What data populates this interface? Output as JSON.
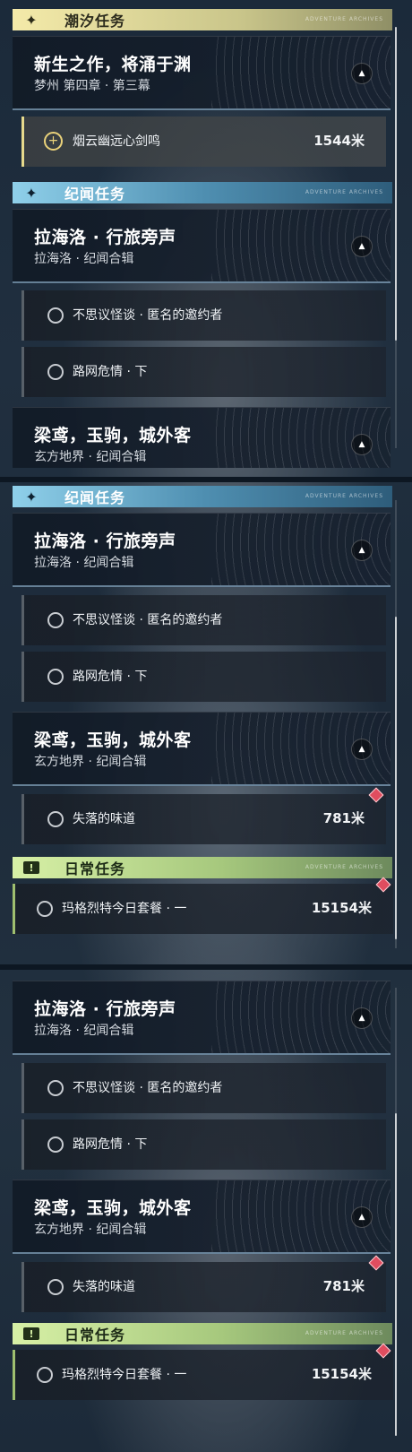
{
  "categories": {
    "tide": {
      "label": "潮汐任务",
      "badge": "✦"
    },
    "lore": {
      "label": "纪闻任务",
      "badge": "✦"
    },
    "daily": {
      "label": "日常任务",
      "badge": "!"
    },
    "deco_text": "ADVENTURE ARCHIVES"
  },
  "quests": {
    "main": {
      "title": "新生之作，将涌于渊",
      "subtitle": "梦州 第四章 · 第三幕"
    },
    "laila": {
      "title": "拉海洛 · 行旅旁声",
      "subtitle": "拉海洛 · 纪闻合辑"
    },
    "liangyuan": {
      "title": "梁鸢，玉驹，城外客",
      "subtitle": "玄方地界 · 纪闻合辑"
    }
  },
  "tasks": {
    "tracked": {
      "name": "烟云幽远心剑鸣",
      "distance": "1544米"
    },
    "mystery": {
      "name": "不思议怪谈 · 匿名的邀约者"
    },
    "network": {
      "name": "路网危情 · 下"
    },
    "lost_taste": {
      "name": "失落的味道",
      "distance": "781米"
    },
    "margaret": {
      "name": "玛格烈特今日套餐 · 一",
      "distance": "15154米"
    }
  },
  "icons": {
    "collapse": "chevron-up-icon",
    "tracked_marker": "plus-circle-icon",
    "task_marker": "ring-icon",
    "pin": "map-pin-diamond-icon"
  },
  "colors": {
    "tide_accent": "#f4eaa9",
    "lore_accent": "#8fd0ea",
    "daily_accent": "#d7f0a6",
    "pin": "#e04d5f"
  }
}
